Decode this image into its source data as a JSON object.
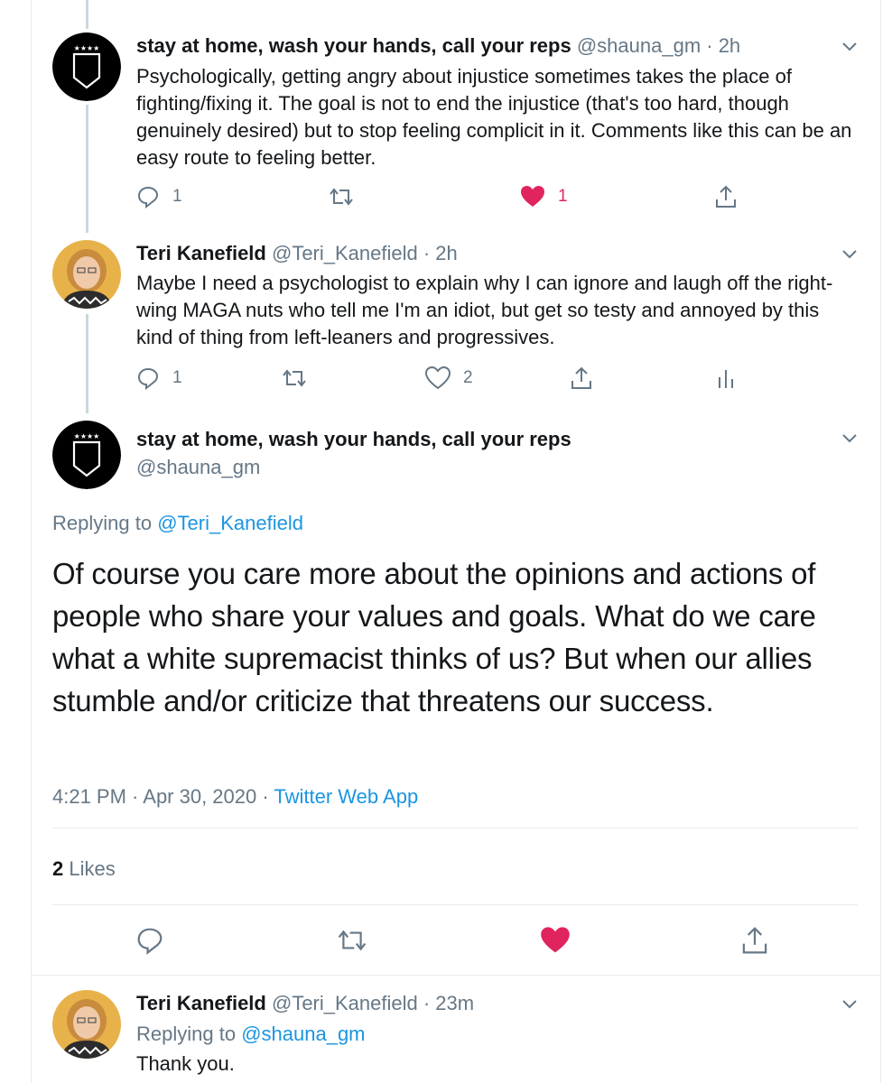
{
  "tweets": [
    {
      "name": "stay at home, wash your hands, call your reps",
      "meta": "@shauna_gm · 2h",
      "text": "Psychologically, getting angry about injustice sometimes takes the place of fighting/fixing it. The goal is not to end the injustice (that's too hard, though genuinely desired) but to stop feeling complicit in it. Comments like this can be an easy route to feeling better.",
      "reply_count": "1",
      "retweet_count": "",
      "like_count": "1"
    },
    {
      "name": "Teri Kanefield",
      "meta": "@Teri_Kanefield · 2h",
      "text": "Maybe I need a psychologist to explain why I can ignore and laugh off the right-wing MAGA nuts who tell me I'm an idiot, but get so testy and annoyed by this kind of thing from left-leaners and progressives.",
      "reply_count": "1",
      "retweet_count": "",
      "like_count": "2"
    }
  ],
  "main_tweet": {
    "name": "stay at home, wash your hands, call your reps",
    "handle": "@shauna_gm",
    "replying_label": "Replying to",
    "replying_to": "@Teri_Kanefield",
    "text": "Of course you care more about the opinions and actions of people who share your values and goals. What do we care what a white supremacist thinks of us?  But when our allies stumble and/or criticize that threatens our success.",
    "time": "4:21 PM · Apr 30, 2020 · ",
    "source": "Twitter Web App",
    "likes_count": "2",
    "likes_label": " Likes"
  },
  "reply": {
    "name": "Teri Kanefield",
    "meta": "@Teri_Kanefield · 23m",
    "replying_label": "Replying to",
    "replying_to": "@shauna_gm",
    "text": "Thank you."
  },
  "colors": {
    "text": "#14171a",
    "muted": "#657786",
    "link": "#1b95e0",
    "like": "#e0245e",
    "thread_line": "#ccd6dd",
    "divider": "#e6ecf0"
  },
  "icons": [
    "reply-icon",
    "retweet-icon",
    "like-icon",
    "share-icon",
    "analytics-icon",
    "chevron-down-icon",
    "shield-avatar",
    "profile-photo-avatar"
  ]
}
